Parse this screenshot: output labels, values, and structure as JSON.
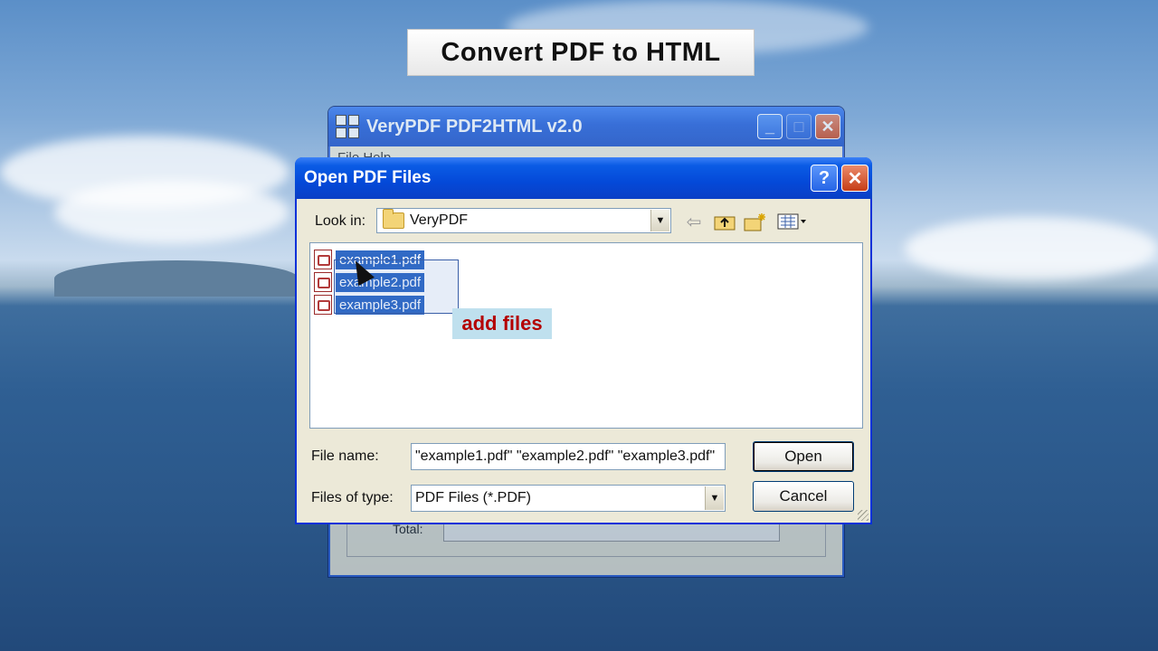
{
  "banner": {
    "title": "Convert PDF to HTML"
  },
  "back_window": {
    "title": "VeryPDF PDF2HTML v2.0",
    "menu": "File   Help",
    "total_label": "Total:"
  },
  "dialog": {
    "title": "Open PDF Files",
    "help_label": "?",
    "close_label": "✕",
    "look_in_label": "Look in:",
    "look_in_value": "VeryPDF",
    "files": [
      {
        "name": "example1.pdf",
        "selected": true
      },
      {
        "name": "example2.pdf",
        "selected": true
      },
      {
        "name": "example3.pdf",
        "selected": true
      }
    ],
    "tooltip": "add files",
    "file_name_label": "File name:",
    "file_name_value": "\"example1.pdf\" \"example2.pdf\" \"example3.pdf\"",
    "file_type_label": "Files of type:",
    "file_type_value": "PDF Files (*.PDF)",
    "open_label": "Open",
    "cancel_label": "Cancel"
  },
  "colors": {
    "titlebar": "#0a5be5",
    "selection": "#316ac5",
    "tooltip_text": "#b40000"
  },
  "icons": [
    "app-icon",
    "minimize-icon",
    "maximize-icon",
    "close-icon",
    "help-icon",
    "folder-icon",
    "back-icon",
    "up-folder-icon",
    "new-folder-icon",
    "view-menu-icon",
    "pdf-icon",
    "mouse-cursor-icon",
    "chevron-down-icon"
  ]
}
